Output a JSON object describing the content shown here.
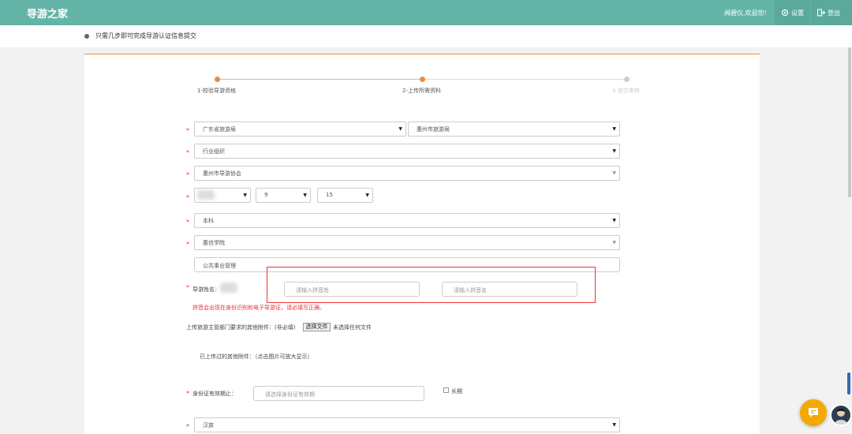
{
  "header": {
    "brand": "导游之家",
    "welcome": "闻碧仪,欢迎您!",
    "settings_label": "设置",
    "logout_label": "登出"
  },
  "notice": "只需几步即可完成导游认证信息提交",
  "steps": [
    {
      "label": "1-校验导游资格",
      "state": "done"
    },
    {
      "label": "2-上传所需资料",
      "state": "active"
    },
    {
      "label": "3-提交审核",
      "state": "todo"
    }
  ],
  "form": {
    "province_bureau": "广东省旅游局",
    "city_bureau": "惠州市旅游局",
    "industry_org": "行业组织",
    "association": "惠州市导游协会",
    "birth_month": "9",
    "birth_day": "15",
    "education": "本科",
    "school": "惠信学院",
    "major": "公共事业管理",
    "guide_name_label": "导游姓名：",
    "pinyin_last_placeholder": "请输入拼音姓",
    "pinyin_first_placeholder": "请输入拼音名",
    "pinyin_warning": "拼音会出现在身份识别和电子导游证，请必填写正确。",
    "upload_label": "上传旅游主管部门要求的其他附件：(非必填)",
    "choose_file_label": "选择文件",
    "no_file_label": "未选择任何文件",
    "uploaded_label": "已上传过的其他附件：（点击图片可放大显示）",
    "id_validity_label": "身份证有效期止：",
    "id_validity_placeholder": "请选择身份证有效期",
    "long_term_label": "长期",
    "ethnicity": "汉族"
  },
  "colors": {
    "header_bg": "#63b4a6",
    "accent": "#f08a3c",
    "required": "#e33333",
    "chat_button": "#f5a800"
  }
}
